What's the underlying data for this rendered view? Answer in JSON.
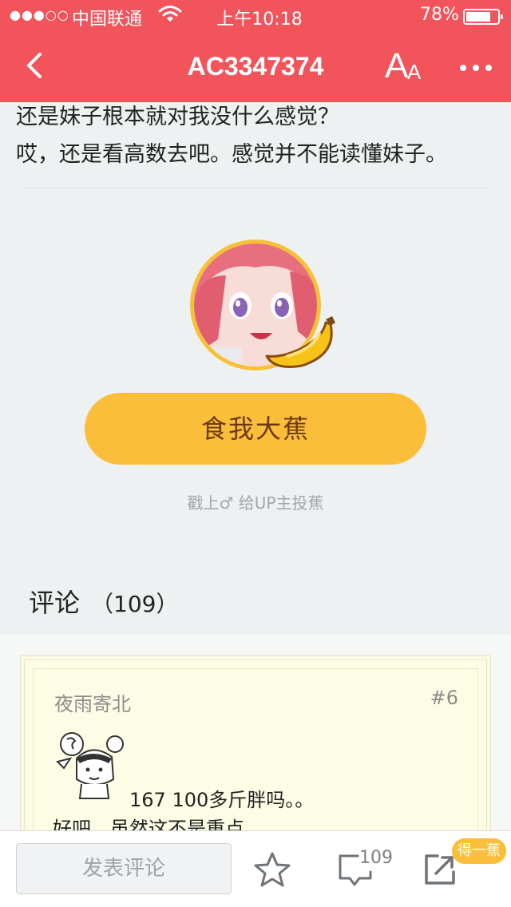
{
  "status_bar": {
    "signal": "●●●○○",
    "carrier": "中国联通",
    "time": "上午10:18",
    "battery": "78%",
    "battery_level": 0.78
  },
  "header": {
    "title": "AC3347374",
    "font_button_big": "A",
    "font_button_small": "A",
    "more_icon": "more-dots-icon",
    "back_icon": "chevron-left-icon",
    "bg_color": "#f2545c"
  },
  "article": {
    "line1": "还是妹子根本就对我没什么感觉？",
    "line2": "哎，还是看高数去吧。感觉并不能读懂妹子。"
  },
  "feed": {
    "button_label": "食我大蕉",
    "hint": "戳上♂ 给UP主投蕉"
  },
  "comments": {
    "title": "评论",
    "count": "（109）",
    "items": [
      {
        "user": "夜雨寄北",
        "floor": "#6",
        "line1": "167 100多斤胖吗。。",
        "line2": "好吧，虽然这不是重点"
      }
    ]
  },
  "bottom_bar": {
    "input_placeholder": "发表评论",
    "message_count": "109",
    "banana_badge": "得一蕉"
  },
  "colors": {
    "accent": "#f2545c",
    "banana": "#fbbe3b",
    "button_text": "#6b3a14"
  }
}
